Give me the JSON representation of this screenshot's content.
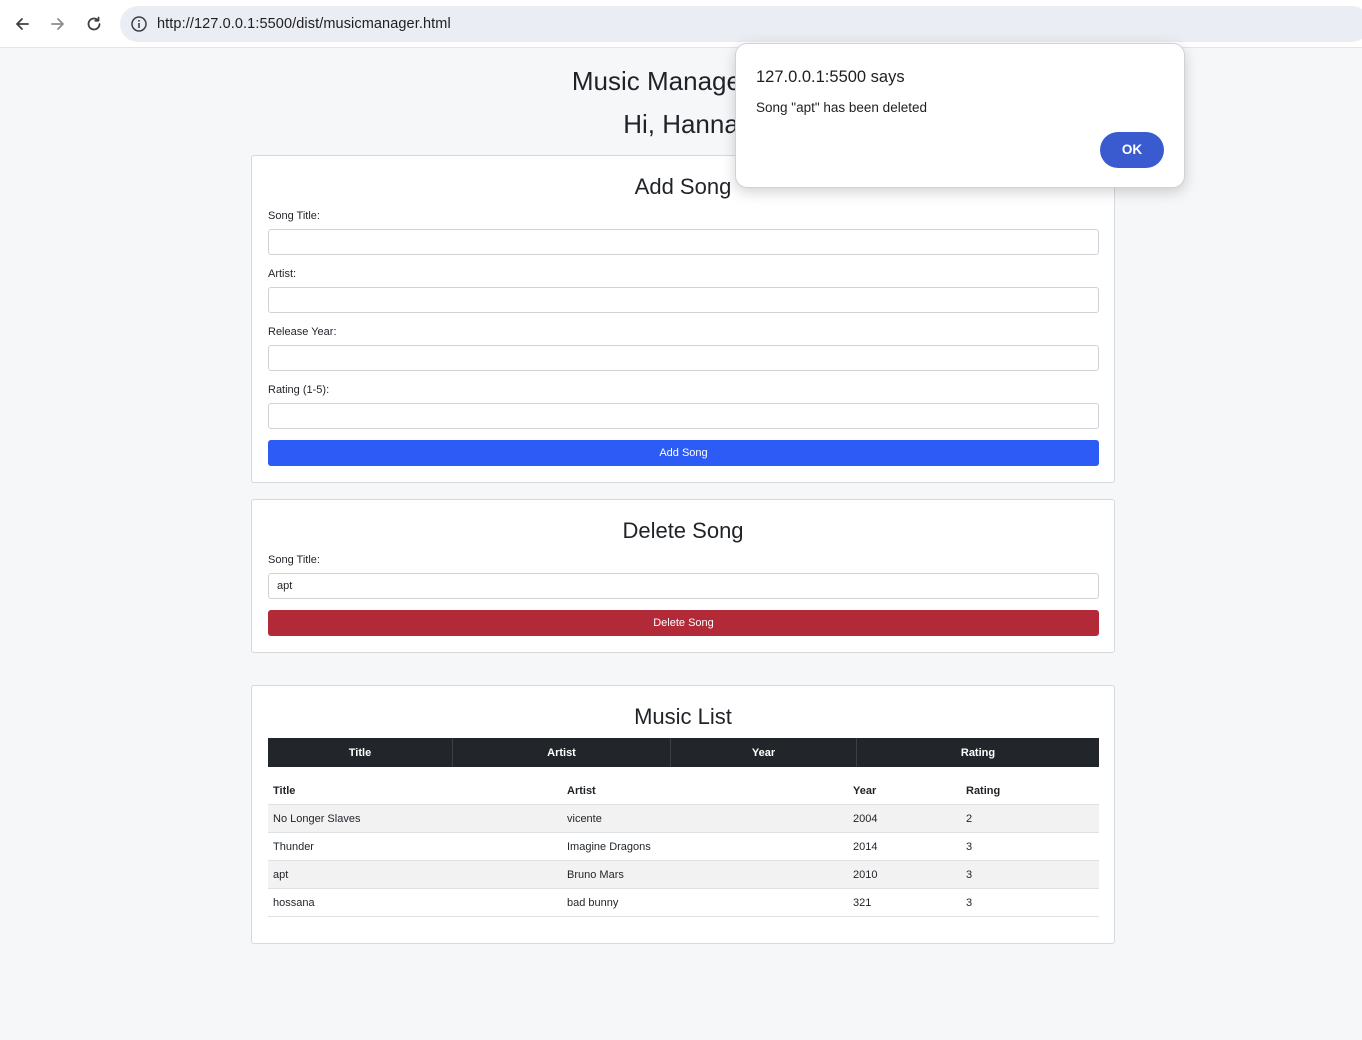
{
  "browser": {
    "url": "http://127.0.0.1:5500/dist/musicmanager.html",
    "back_icon": "arrow-left-icon",
    "forward_icon": "arrow-right-icon",
    "reload_icon": "reload-icon",
    "info_icon": "info-icon"
  },
  "header": {
    "title": "Music Manager Ho",
    "greeting": "Hi, Hanna"
  },
  "add_song": {
    "heading": "Add Song",
    "title_label": "Song Title:",
    "title_value": "",
    "artist_label": "Artist:",
    "artist_value": "",
    "year_label": "Release Year:",
    "year_value": "",
    "rating_label": "Rating (1-5):",
    "rating_value": "",
    "button_label": "Add Song",
    "button_color": "#2d5bf5"
  },
  "delete_song": {
    "heading": "Delete Song",
    "title_label": "Song Title:",
    "title_value": "apt",
    "button_label": "Delete Song",
    "button_color": "#b22a37"
  },
  "music_list": {
    "heading": "Music List",
    "dark_headers": [
      "Title",
      "Artist",
      "Year",
      "Rating"
    ],
    "columns": [
      "Title",
      "Artist",
      "Year",
      "Rating"
    ],
    "rows": [
      {
        "title": "No Longer Slaves",
        "artist": "vicente",
        "year": "2004",
        "rating": "2"
      },
      {
        "title": "Thunder",
        "artist": "Imagine Dragons",
        "year": "2014",
        "rating": "3"
      },
      {
        "title": "apt",
        "artist": "Bruno Mars",
        "year": "2010",
        "rating": "3"
      },
      {
        "title": "hossana",
        "artist": "bad bunny",
        "year": "321",
        "rating": "3"
      }
    ]
  },
  "dialog": {
    "title": "127.0.0.1:5500 says",
    "message": "Song \"apt\" has been deleted",
    "ok_label": "OK",
    "ok_color": "#3a5bd0"
  }
}
